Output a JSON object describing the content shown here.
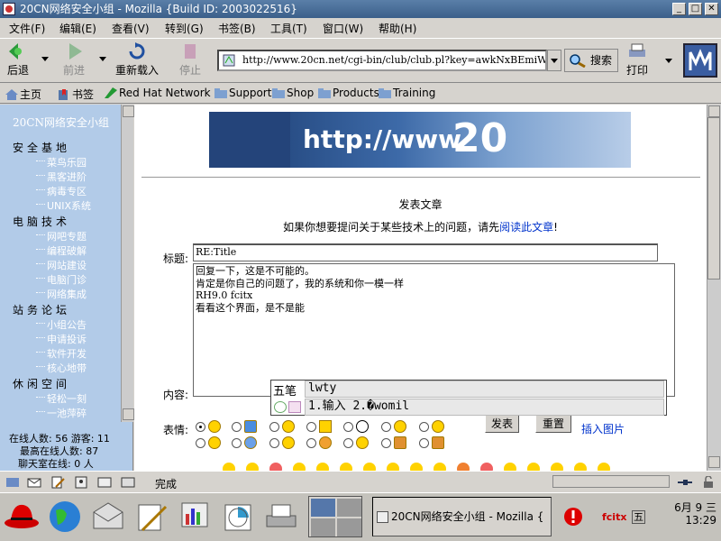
{
  "window": {
    "title": "20CN网络安全小组 - Mozilla {Build ID: 2003022516}"
  },
  "menu": [
    "文件(F)",
    "编辑(E)",
    "查看(V)",
    "转到(G)",
    "书签(B)",
    "工具(T)",
    "窗口(W)",
    "帮助(H)"
  ],
  "nav": {
    "back": "后退",
    "forward": "前进",
    "reload": "重新载入",
    "stop": "停止",
    "url": "http://www.20cn.net/cgi-bin/club/club.pl?key=awkNxBEmiWwO",
    "search": "搜索",
    "print": "打印"
  },
  "personal_toolbar": {
    "home": "主页",
    "bookmarks": "书签",
    "items": [
      "Red Hat Network",
      "Support",
      "Shop",
      "Products",
      "Training"
    ]
  },
  "sidebar": {
    "title": "20CN网络安全小组",
    "sections": [
      {
        "name": "安全基地",
        "items": [
          "菜鸟乐园",
          "黑客进阶",
          "病毒专区",
          "UNIX系统"
        ]
      },
      {
        "name": "电脑技术",
        "items": [
          "网吧专题",
          "编程破解",
          "网站建设",
          "电脑门诊",
          "网络集成"
        ]
      },
      {
        "name": "站务论坛",
        "items": [
          "小组公告",
          "申请投诉",
          "软件开发",
          "核心地带"
        ]
      },
      {
        "name": "休闲空间",
        "items": [
          "轻松一刻",
          "一池萍碎"
        ]
      }
    ],
    "stats": {
      "online": "在线人数: 56  游客: 11",
      "max_online": "最高在线人数: 87",
      "chat_online": "聊天室在线:  0 人"
    }
  },
  "main": {
    "banner_text": "http://www",
    "post_title": "发表文章",
    "tip_prefix": "如果你想要提问关于某些技术上的问题，请先",
    "tip_link": "阅读此文章",
    "tip_suffix": "!",
    "title_label": "标题:",
    "title_value": "RE:Title",
    "content_label": "内容:",
    "content_lines": [
      "回复一下，这是不可能的。",
      "肯定是你自己的问题了，我的系统和你一模一样",
      "RH9.0  fcitx",
      "看看这个界面，是不是能"
    ],
    "emotion_label": "表情:",
    "submit": "发表",
    "reset": "重置",
    "insert_image": "插入图片"
  },
  "ime": {
    "mode": "五笔",
    "input": "lwty",
    "candidates": "1.输入 2.�womil"
  },
  "status": {
    "text": "完成"
  },
  "taskbar": {
    "window_title": "20CN网络安全小组 - Mozilla {",
    "tray_fcitx": "fcitx",
    "tray_mode": "五",
    "date": "6月  9  三",
    "time": "13:29"
  },
  "colors": {
    "sidebar_bg": "#b2cbe8",
    "titlebar": "#3b5f8a",
    "link": "#0033cc"
  }
}
